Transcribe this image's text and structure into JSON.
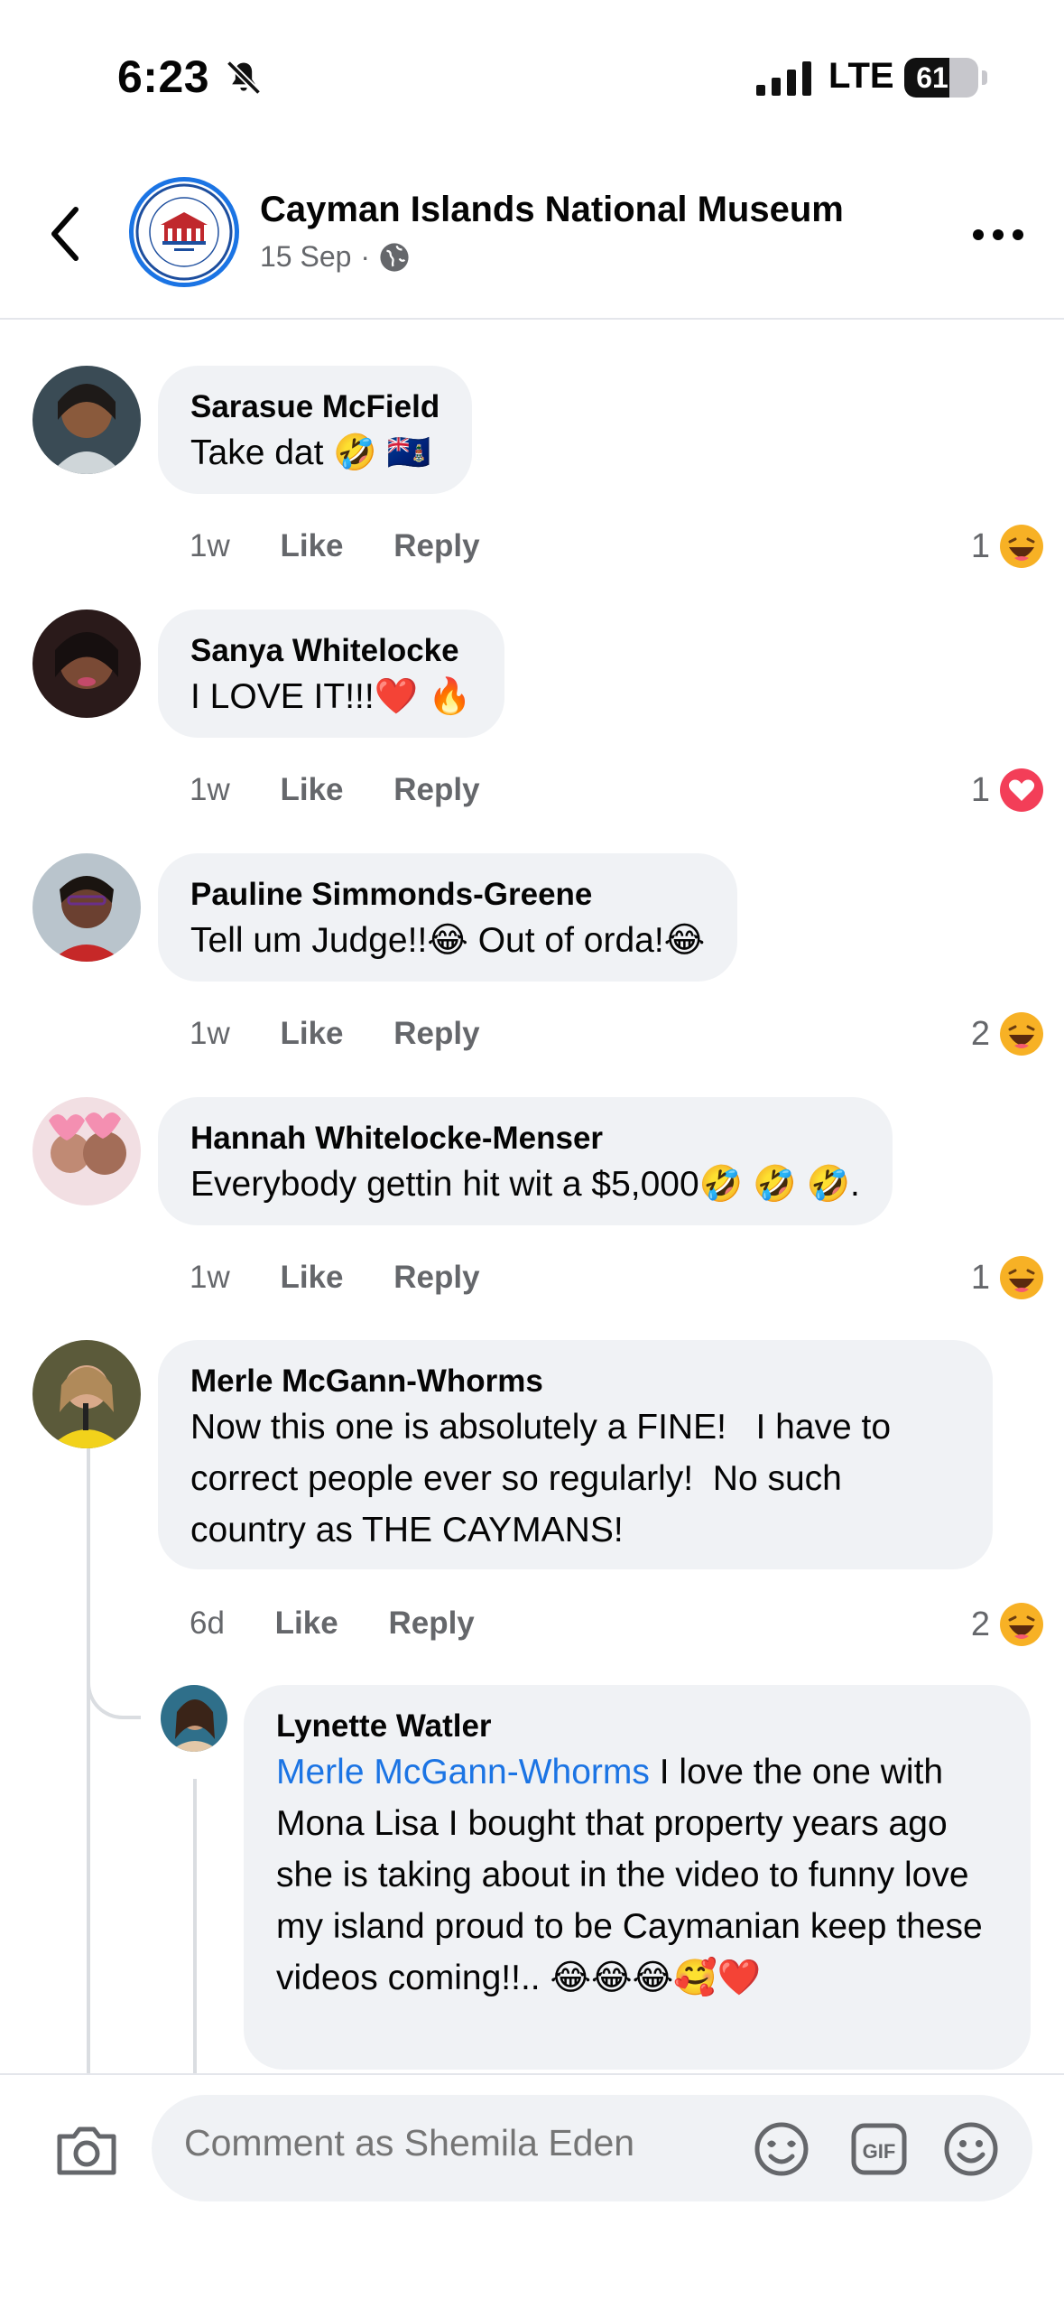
{
  "status_bar": {
    "time": "6:23",
    "network": "LTE",
    "battery": "61",
    "battery_level": 0.61
  },
  "header": {
    "page_name": "Cayman Islands National Museum",
    "date": "15 Sep",
    "separator": "·"
  },
  "comments": [
    {
      "author": "Sarasue McField",
      "text": "Take dat 🤣 🇰🇾",
      "time": "1w",
      "like": "Like",
      "reply": "Reply",
      "reaction_count": "1",
      "reaction": "haha"
    },
    {
      "author": "Sanya Whitelocke",
      "text": "I LOVE IT!!!❤️ 🔥",
      "time": "1w",
      "like": "Like",
      "reply": "Reply",
      "reaction_count": "1",
      "reaction": "love"
    },
    {
      "author": "Pauline Simmonds-Greene",
      "text": "Tell um Judge!!😂 Out of orda!😂",
      "time": "1w",
      "like": "Like",
      "reply": "Reply",
      "reaction_count": "2",
      "reaction": "haha"
    },
    {
      "author": "Hannah Whitelocke-Menser",
      "text": "Everybody gettin hit wit a $5,000🤣 🤣 🤣.",
      "time": "1w",
      "like": "Like",
      "reply": "Reply",
      "reaction_count": "1",
      "reaction": "haha"
    },
    {
      "author": "Merle McGann-Whorms",
      "text": "Now this one is absolutely a FINE!   I have to correct people ever so regularly!  No such country as THE CAYMANS!",
      "time": "6d",
      "like": "Like",
      "reply": "Reply",
      "reaction_count": "2",
      "reaction": "haha"
    }
  ],
  "reply": {
    "author": "Lynette Watler",
    "mention": "Merle McGann-Whorms",
    "text": " I love the one with Mona Lisa I bought that property years ago she is taking about in the video to funny love my island proud to be Caymanian keep these videos coming!!.. 😂😂😂🥰❤️"
  },
  "composer": {
    "placeholder": "Comment as Shemila Eden"
  },
  "icons": {
    "back": "chevron-left-icon",
    "more": "more-dots-icon",
    "audience": "globe-icon",
    "camera": "camera-icon",
    "sticker": "sticker-icon",
    "gif": "gif-icon",
    "emoji": "smile-icon"
  },
  "colors": {
    "link": "#1b74e4",
    "bubble": "#f0f2f5",
    "secondary_text": "#65676b",
    "love": "#f33e58",
    "haha": "#f7b125"
  }
}
